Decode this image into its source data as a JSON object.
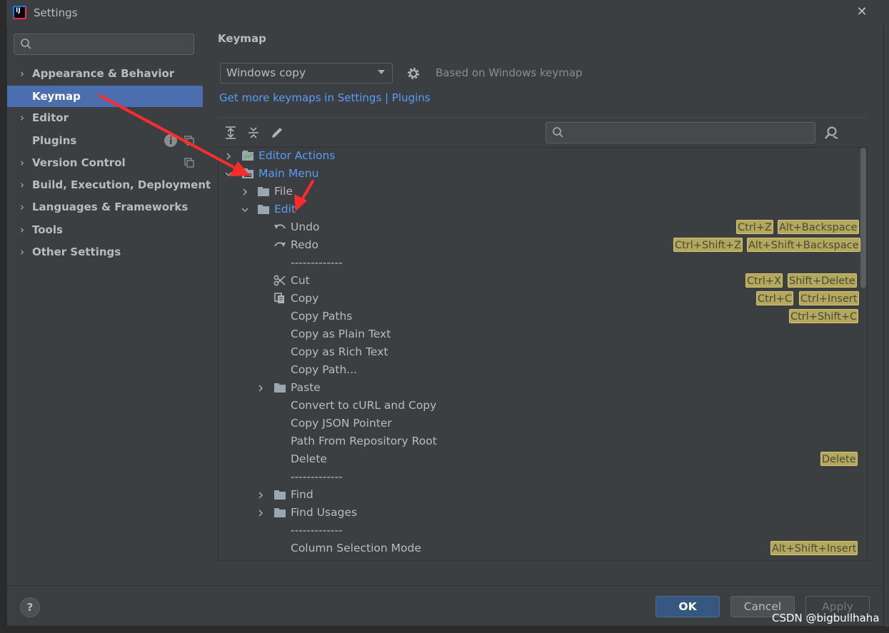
{
  "window": {
    "title": "Settings"
  },
  "sidebar": {
    "search_placeholder": "",
    "items": [
      {
        "label": "Appearance & Behavior",
        "expandable": true
      },
      {
        "label": "Keymap",
        "expandable": false,
        "selected": true
      },
      {
        "label": "Editor",
        "expandable": true
      },
      {
        "label": "Plugins",
        "expandable": false
      },
      {
        "label": "Version Control",
        "expandable": true
      },
      {
        "label": "Build, Execution, Deployment",
        "expandable": true
      },
      {
        "label": "Languages & Frameworks",
        "expandable": true
      },
      {
        "label": "Tools",
        "expandable": true
      },
      {
        "label": "Other Settings",
        "expandable": true
      }
    ]
  },
  "main": {
    "title": "Keymap",
    "keymap_select": {
      "value": "Windows copy"
    },
    "based_on": "Based on Windows keymap",
    "more_link": "Get more keymaps in Settings | Plugins",
    "tree_search_placeholder": ""
  },
  "tree": {
    "editor_actions": "Editor Actions",
    "main_menu": "Main Menu",
    "file": "File",
    "edit": "Edit",
    "undo": {
      "label": "Undo",
      "shortcuts": [
        "Ctrl+Z",
        "Alt+Backspace"
      ]
    },
    "redo": {
      "label": "Redo",
      "shortcuts": [
        "Ctrl+Shift+Z",
        "Alt+Shift+Backspace"
      ]
    },
    "sep": "-------------",
    "cut": {
      "label": "Cut",
      "shortcuts": [
        "Ctrl+X",
        "Shift+Delete"
      ]
    },
    "copy": {
      "label": "Copy",
      "shortcuts": [
        "Ctrl+C",
        "Ctrl+Insert"
      ]
    },
    "copy_paths": {
      "label": "Copy Paths",
      "shortcuts": [
        "Ctrl+Shift+C"
      ]
    },
    "copy_plain": "Copy as Plain Text",
    "copy_rich": "Copy as Rich Text",
    "copy_path": "Copy Path...",
    "paste": "Paste",
    "convert_curl": "Convert to cURL and Copy",
    "copy_json": "Copy JSON Pointer",
    "path_repo": "Path From Repository Root",
    "delete": {
      "label": "Delete",
      "shortcuts": [
        "Delete"
      ]
    },
    "find": "Find",
    "find_usages": "Find Usages",
    "column_mode": {
      "label": "Column Selection Mode",
      "shortcuts": [
        "Alt+Shift+Insert"
      ]
    }
  },
  "buttons": {
    "help": "?",
    "ok": "OK",
    "cancel": "Cancel",
    "apply": "Apply"
  },
  "watermark": "CSDN @bigbullhaha",
  "colors": {
    "accent": "#4b6eaf",
    "link": "#589df6",
    "shortcut_bg": "#b3a85b",
    "annotation": "#ff2b2b"
  }
}
